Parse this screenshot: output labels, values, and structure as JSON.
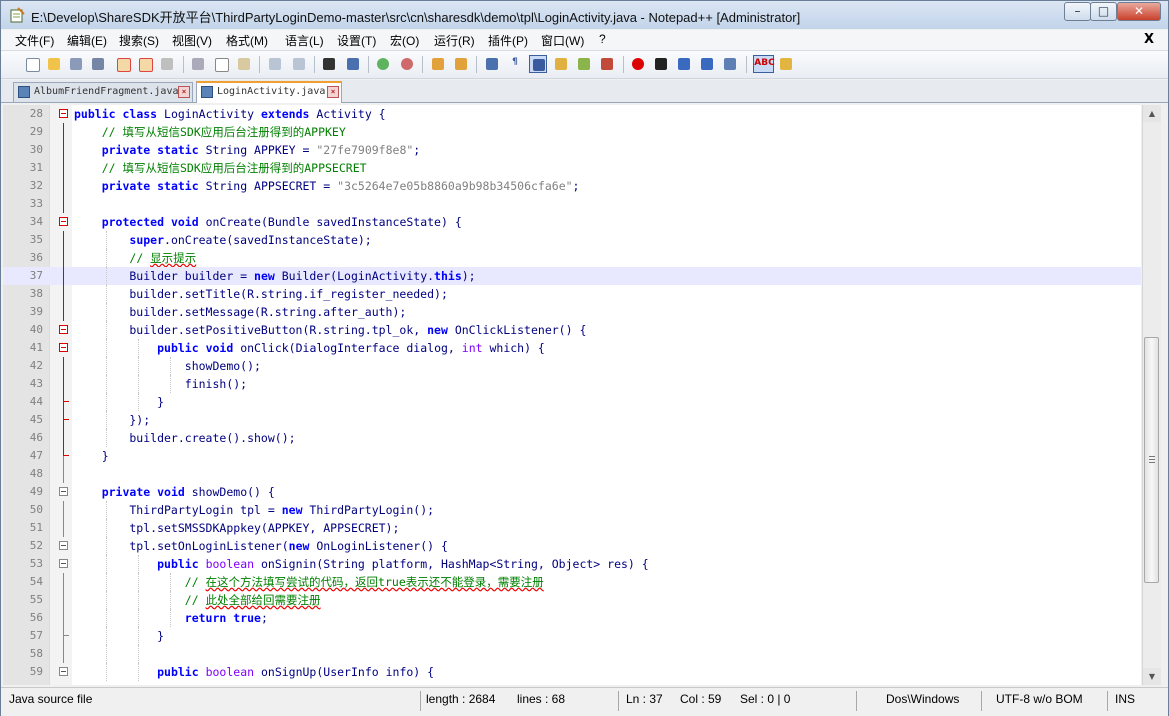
{
  "window": {
    "title": "E:\\Develop\\ShareSDK开放平台\\ThirdPartyLoginDemo-master\\src\\cn\\sharesdk\\demo\\tpl\\LoginActivity.java - Notepad++ [Administrator]",
    "buttons": {
      "minimize": "–",
      "maximize": "□",
      "close": "✕"
    }
  },
  "menu": {
    "items": [
      "文件(F)",
      "编辑(E)",
      "搜索(S)",
      "视图(V)",
      "格式(M)",
      "语言(L)",
      "设置(T)",
      "宏(O)",
      "运行(R)",
      "插件(P)",
      "窗口(W)",
      "?"
    ],
    "close_label": "X"
  },
  "toolbar": {
    "icons": [
      "new-file-icon",
      "open-file-icon",
      "save-icon",
      "save-all-icon",
      "close-file-icon",
      "close-all-icon",
      "print-icon",
      "cut-icon",
      "copy-icon",
      "paste-icon",
      "undo-icon",
      "redo-icon",
      "find-icon",
      "replace-icon",
      "zoom-in-icon",
      "zoom-out-icon",
      "sync-vertical-icon",
      "sync-horizontal-icon",
      "word-wrap-icon",
      "show-all-chars-icon",
      "indent-guide-icon",
      "user-language-icon",
      "function-list-icon",
      "document-map-icon",
      "record-macro-icon",
      "stop-record-icon",
      "play-macro-icon",
      "run-macro-multiple-icon",
      "save-macro-icon",
      "spellcheck-icon",
      "change-dictionary-icon"
    ],
    "spellcheck_label": "ABC"
  },
  "tabs": [
    {
      "label": "AlbumFriendFragment.java",
      "active": false
    },
    {
      "label": "LoginActivity.java",
      "active": true
    }
  ],
  "editor": {
    "current_line": 37,
    "lines": [
      28,
      29,
      30,
      31,
      32,
      33,
      34,
      35,
      36,
      37,
      38,
      39,
      40,
      41,
      42,
      43,
      44,
      45,
      46,
      47,
      48,
      49,
      50,
      51,
      52,
      53,
      54,
      55,
      56,
      57,
      58,
      59
    ]
  },
  "status": {
    "file_type": "Java source file",
    "length": "length : 2684",
    "lines": "lines : 68",
    "ln": "Ln : 37",
    "col": "Col : 59",
    "sel": "Sel : 0 | 0",
    "eol": "Dos\\Windows",
    "encoding": "UTF-8 w/o BOM",
    "mode": "INS"
  },
  "colors": {
    "keyword": "#0000ff",
    "type": "#8000ff",
    "string": "#808080",
    "comment": "#008000",
    "identifier": "#000080",
    "current_line": "#e8e8ff"
  }
}
